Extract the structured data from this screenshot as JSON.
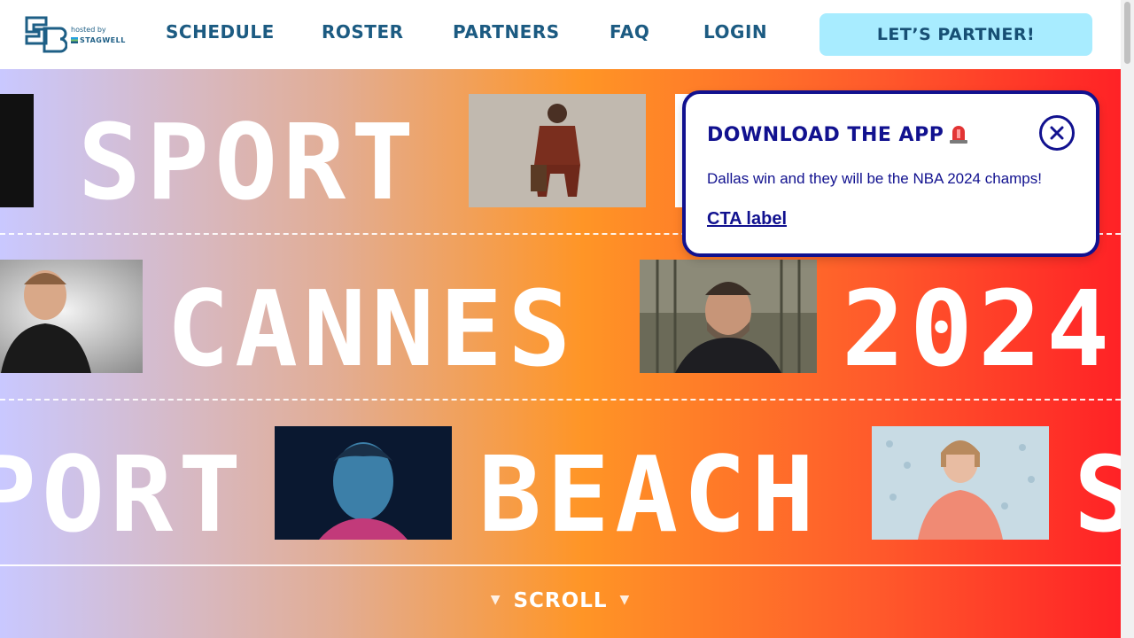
{
  "header": {
    "logo": {
      "hosted_by": "hosted by",
      "brand": "STAGWELL"
    },
    "nav": [
      {
        "label": "SCHEDULE"
      },
      {
        "label": "ROSTER"
      },
      {
        "label": "PARTNERS"
      },
      {
        "label": "FAQ"
      },
      {
        "label": "LOGIN"
      }
    ],
    "cta_label": "LET’S PARTNER!"
  },
  "hero": {
    "row1": {
      "words": [
        "SPORT"
      ]
    },
    "row2": {
      "words": [
        "CANNES",
        "2024"
      ]
    },
    "row3": {
      "words": [
        "PORT",
        "BEACH",
        "S"
      ]
    },
    "scroll_label": "SCROLL",
    "scroll_arrow": "▼"
  },
  "popup": {
    "title": "DOWNLOAD THE APP",
    "body": "Dallas win and they will be the NBA 2024 champs!",
    "link_label": "CTA label"
  },
  "colors": {
    "brand_dark": "#1c5b82",
    "cta_bg": "#a8ecff",
    "popup_navy": "#11118f",
    "gradient": [
      "#c9c8ff",
      "#e2ad94",
      "#ff9526",
      "#ff5a2b",
      "#ff2226"
    ]
  },
  "icons": {
    "logo": "sb-logo-icon",
    "close": "close-icon",
    "siren": "siren-icon",
    "scroll_arrows": "triangle-down-icon"
  }
}
